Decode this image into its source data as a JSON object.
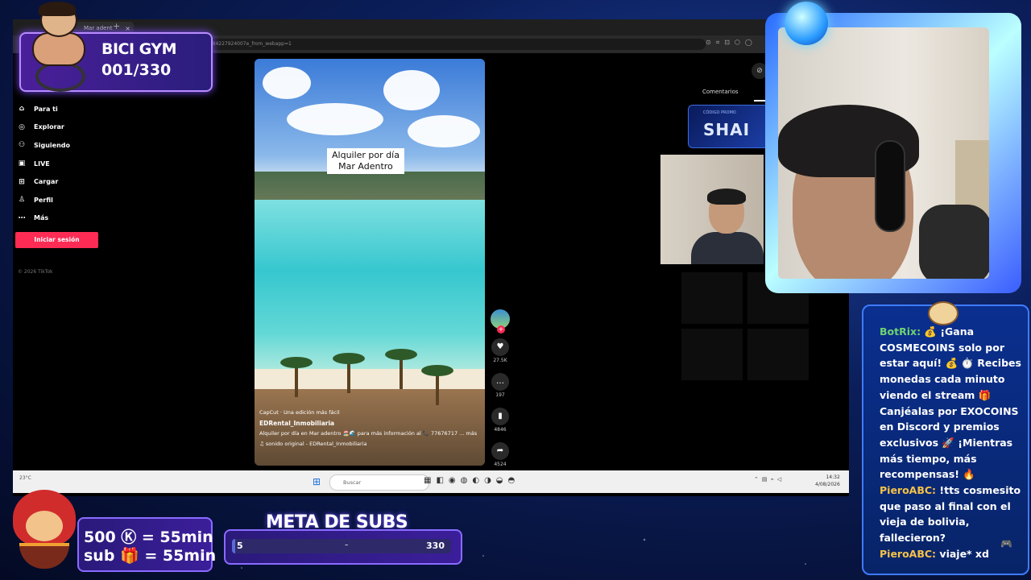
{
  "browser": {
    "tab_title": "Mar adent",
    "url": "7684227924007e_from_webapp=1"
  },
  "sidebar": {
    "items": [
      {
        "label": "Para ti",
        "icon": "home-icon"
      },
      {
        "label": "Explorar",
        "icon": "compass-icon"
      },
      {
        "label": "Siguiendo",
        "icon": "users-icon"
      },
      {
        "label": "LIVE",
        "icon": "live-icon"
      },
      {
        "label": "Cargar",
        "icon": "upload-icon"
      },
      {
        "label": "Perfil",
        "icon": "profile-icon"
      },
      {
        "label": "Más",
        "icon": "more-icon"
      }
    ],
    "login_label": "Iniciar sesión",
    "copyright": "© 2026 TikTok"
  },
  "video": {
    "caption_line1": "Alquiler por día",
    "caption_line2": "Mar Adentro",
    "capcut": "CapCut · Una edición más fácil",
    "author": "EDRental_Inmobiliaria",
    "description": "Alquiler por día en Mar adentro 🏖️🌊 para más información al 📞 77676717 ... más",
    "sound": "♫ sonido original - EDRental_Inmobiliaria"
  },
  "actions": {
    "likes": "27.5K",
    "comments": "197",
    "saves": "4846",
    "shares": "4524"
  },
  "panel": {
    "comments_label": "Comentarios",
    "promo_small": "CÓDIGO PROMO",
    "promo_text": "SHAI"
  },
  "taskbar": {
    "weather": "23°C",
    "search_placeholder": "Buscar",
    "time": "14:32",
    "date": "4/08/2026"
  },
  "overlay": {
    "bici_title": "BICI GYM",
    "bici_count": "001/330",
    "sub_line1": "500 Ⓚ = 55min",
    "sub_line2": "sub 🎁 = 55min",
    "meta_title": "META DE SUBS",
    "meta_start": "5",
    "meta_end": "330",
    "meta_progress": 0.015
  },
  "chat": {
    "messages": [
      {
        "name": "BotRix:",
        "text": " 💰 ¡Gana COSMECOINS solo por estar aquí! 💰 ⏱️ Recibes monedas cada minuto viendo el stream 🎁 Canjéalas por EXOCOINS en Discord y premios exclusivos 🚀 ¡Mientras más tiempo, más recompensas! 🔥",
        "bot": true
      },
      {
        "name": "PieroABC:",
        "text": " !tts cosmesito que paso al final con el vieja de bolivia, fallecieron?",
        "bot": false
      },
      {
        "name": "PieroABC:",
        "text": " viaje* xd",
        "bot": false
      }
    ]
  },
  "colors": {
    "tiktok_pink": "#fe2c55",
    "chat_name": "#f6c248",
    "bot_name": "#6fd36f",
    "panel_border": "#8a6bff"
  }
}
